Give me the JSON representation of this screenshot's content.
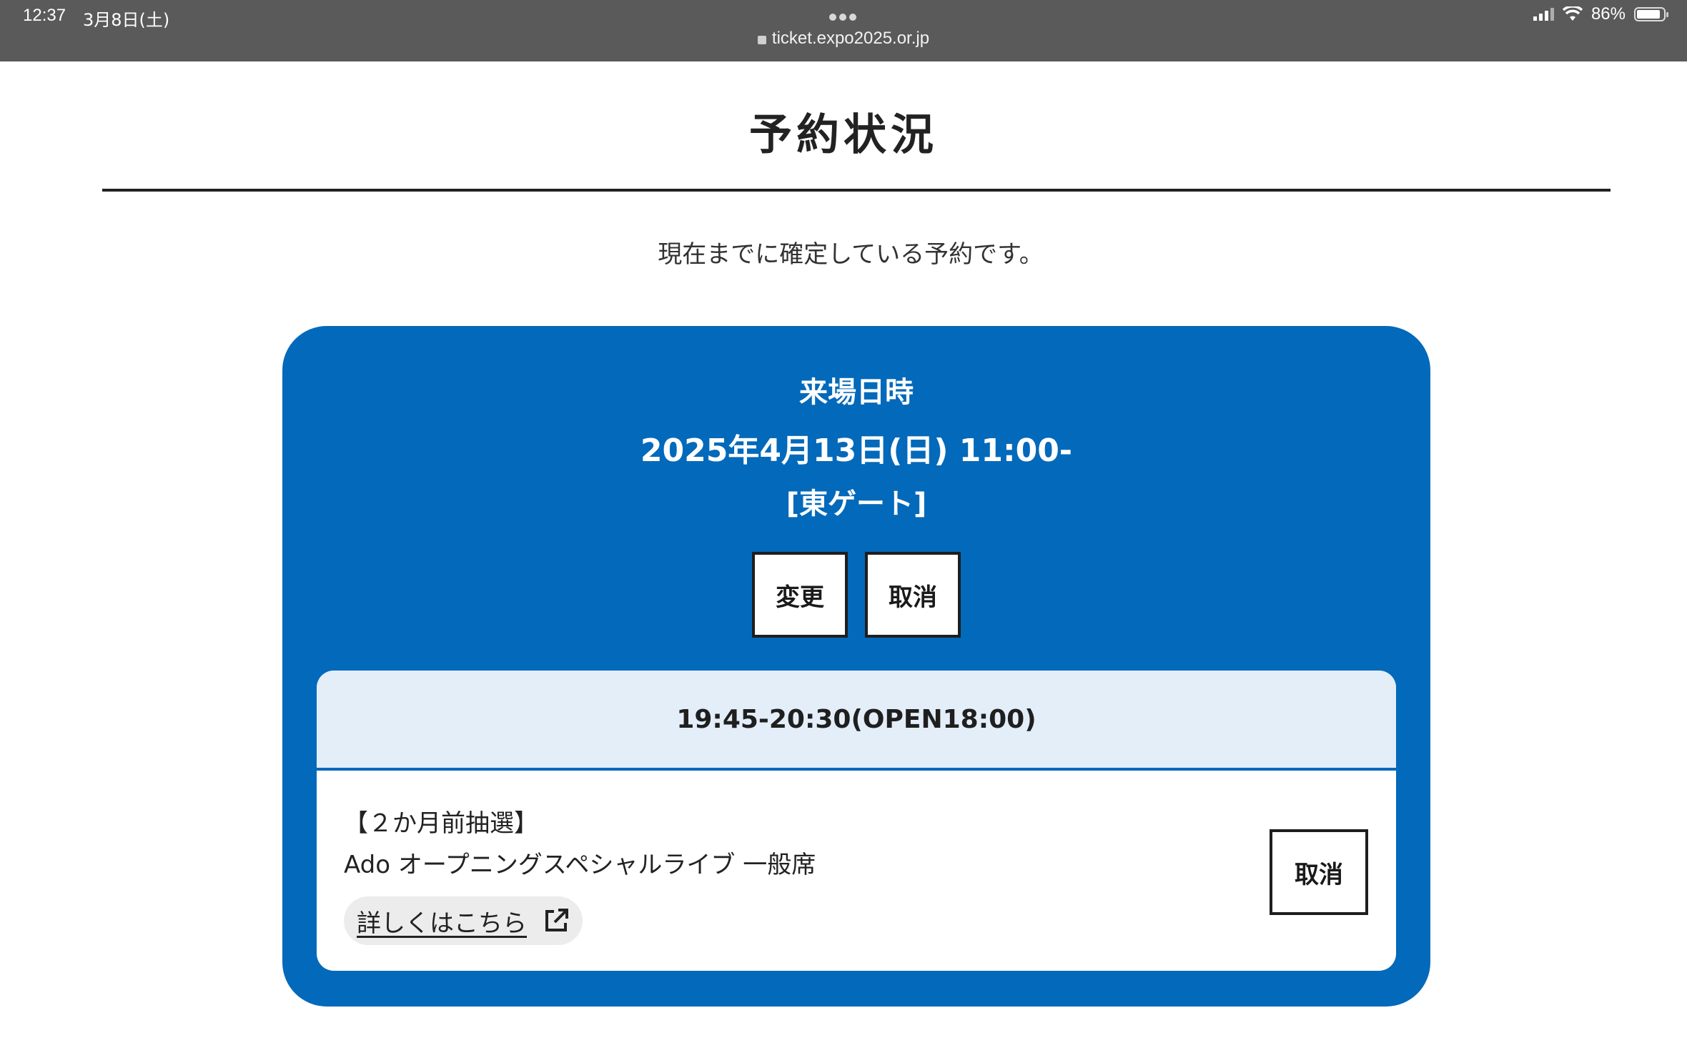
{
  "status_bar": {
    "time": "12:37",
    "date": "3月8日(土)",
    "url": "ticket.expo2025.or.jp",
    "battery": "86%"
  },
  "page": {
    "title": "予約状況",
    "intro": "現在までに確定している予約です。"
  },
  "reservation": {
    "visit_label": "来場日時",
    "visit_datetime": "2025年4月13日(日) 11:00-",
    "gate": "[東ゲート]",
    "change_button": "変更",
    "cancel_button": "取消",
    "accent_color": "#0369ba"
  },
  "event": {
    "time": "19:45-20:30(OPEN18:00)",
    "lottery": "【２か月前抽選】",
    "name": "Ado オープニングスペシャルライブ 一般席",
    "details_link": "詳しくはこちら",
    "link_icon": "external-link-icon",
    "cancel_button": "取消"
  }
}
